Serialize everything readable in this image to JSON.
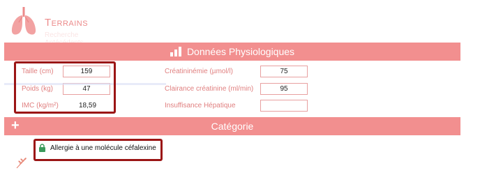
{
  "header": {
    "title": "Terrains",
    "ghost_line1": "Recherche",
    "ghost_line2": "Antécédents"
  },
  "physio": {
    "section_title": "Données  Physiologiques",
    "taille_label": "Taille (cm)",
    "taille_value": "159",
    "poids_label": "Poids (kg)",
    "poids_value": "47",
    "imc_label": "IMC (kg/m²)",
    "imc_value": "18,59",
    "creat_label": "Créatininémie (µmol/l)",
    "creat_value": "75",
    "clairance_label": "Clairance créatinine (ml/min)",
    "clairance_value": "95",
    "insuff_label": "Insuffisance Hépatique",
    "insuff_value": ""
  },
  "category": {
    "section_title": "Catégorie",
    "allergy_text": "Allergie à une molécule céfalexine"
  },
  "colors": {
    "band": "#f28f8f",
    "label": "#e07f7f",
    "highlight": "#9b1515",
    "lock": "#3a9a5b"
  },
  "icons": [
    "lungs-icon",
    "bar-chart-icon",
    "plus-icon",
    "lock-icon",
    "wheat-icon"
  ]
}
